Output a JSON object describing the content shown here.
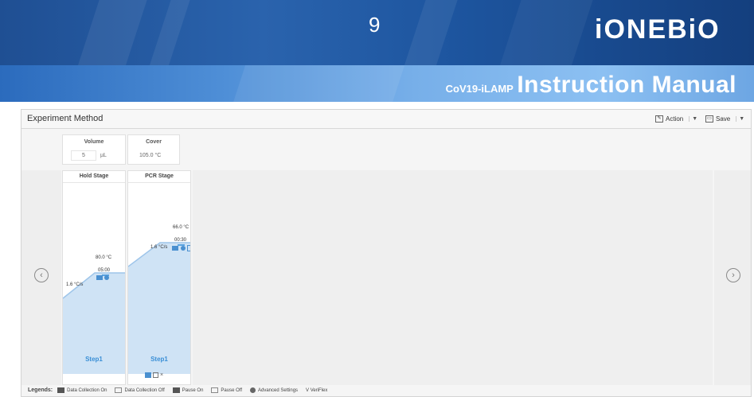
{
  "header": {
    "page_number": "9",
    "brand": "iONEBiO",
    "manual_prefix": "CoV19-iLAMP",
    "manual_title": "Instruction Manual"
  },
  "panel": {
    "title": "Experiment Method",
    "action_label": "Action",
    "save_label": "Save",
    "volume_label": "Volume",
    "volume_value": "5",
    "volume_unit": "µL",
    "cover_label": "Cover",
    "cover_value": "105.0 °C"
  },
  "stages": [
    {
      "title": "Hold Stage",
      "temperature": "80.0 °C",
      "time": "05:00",
      "ramp": "1.6 °C/s",
      "step": "Step1"
    },
    {
      "title": "PCR Stage",
      "temperature": "66.0 °C",
      "time": "00:30",
      "ramp": "1.6 °C/s",
      "step": "Step1"
    }
  ],
  "legend": {
    "title": "Legends:",
    "items": [
      "Data Collection On",
      "Data Collection Off",
      "Pause On",
      "Pause Off",
      "Advanced Settings",
      "V VeriFlex"
    ]
  },
  "colors": {
    "banner_dark": "#1f4f93",
    "banner_light": "#77afe9",
    "profile_fill": "#cfe3f5",
    "profile_line": "#9ec5ea",
    "accent_blue": "#3a8fd6"
  }
}
